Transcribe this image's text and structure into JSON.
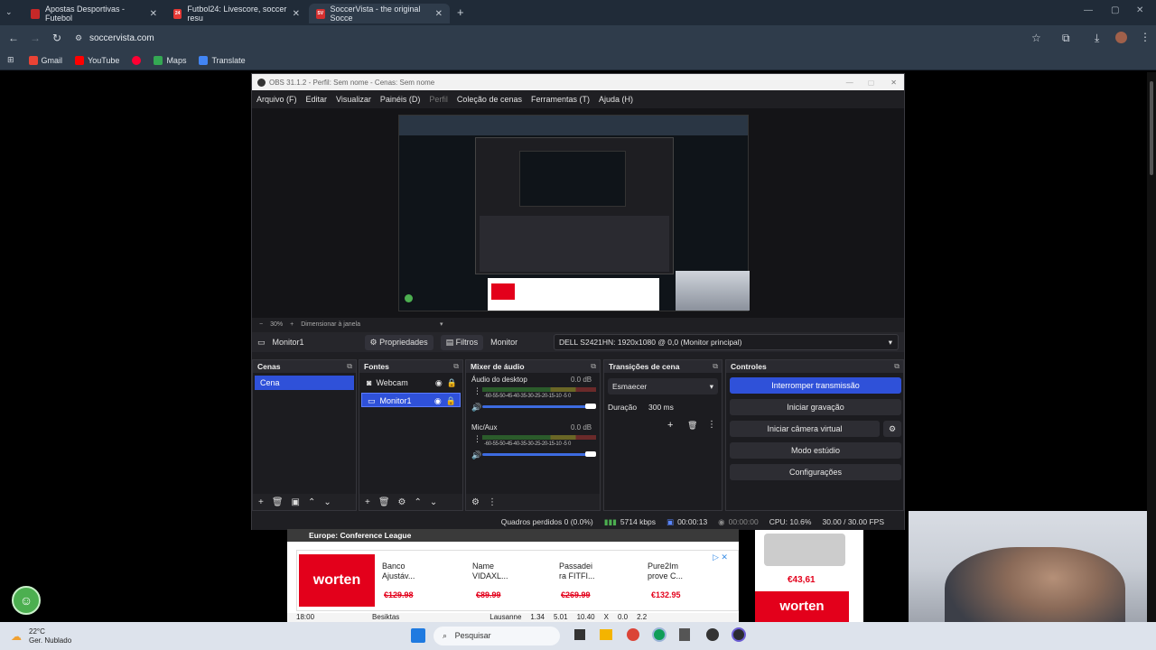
{
  "browser": {
    "tabs": [
      {
        "title": "Apostas Desportivas - Futebol",
        "icon_color": "#c62828",
        "icon_text": ""
      },
      {
        "title": "Futbol24: Livescore, soccer resu",
        "icon_color": "#e53935",
        "icon_text": "24"
      },
      {
        "title": "SoccerVista - the original Socce",
        "icon_color": "#d32f2f",
        "icon_text": "SV",
        "active": true
      }
    ],
    "url": "soccervista.com",
    "bookmarks": [
      "Gmail",
      "YouTube",
      "Maps",
      "Translate"
    ]
  },
  "obs": {
    "title": "OBS 31.1.2 - Perfil: Sem nome - Cenas: Sem nome",
    "menu": [
      "Arquivo (F)",
      "Editar",
      "Visualizar",
      "Painéis (D)",
      "Perfil",
      "Coleção de cenas",
      "Ferramentas (T)",
      "Ajuda (H)"
    ],
    "zoom": "30%",
    "resize_label": "Dimensionar à janela",
    "source_name": "Monitor1",
    "properties_label": "Propriedades",
    "filters_label": "Filtros",
    "monitor_label": "Monitor",
    "monitor_value": "DELL S2421HN: 1920x1080 @ 0,0 (Monitor principal)",
    "docks": {
      "scenes": {
        "title": "Cenas",
        "items": [
          "Cena"
        ]
      },
      "sources": {
        "title": "Fontes",
        "items": [
          "Webcam",
          "Monitor1"
        ]
      },
      "mixer": {
        "title": "Mixer de áudio",
        "channels": [
          {
            "name": "Áudio do desktop",
            "db": "0.0 dB"
          },
          {
            "name": "Mic/Aux",
            "db": "0.0 dB"
          }
        ],
        "scale": "-60-55-50-45-40-35-30-25-20-15-10 -5  0"
      },
      "transitions": {
        "title": "Transições de cena",
        "transition": "Esmaecer",
        "duration_label": "Duração",
        "duration": "300 ms"
      },
      "controls": {
        "title": "Controles",
        "buttons": [
          "Interromper transmissão",
          "Iniciar gravação",
          "Iniciar câmera virtual",
          "Modo estúdio",
          "Configurações"
        ]
      }
    },
    "status": {
      "dropped": "Quadros perdidos 0 (0.0%)",
      "bitrate": "5714 kbps",
      "live_time": "00:00:13",
      "rec_time": "00:00:00",
      "cpu": "CPU: 10.6%",
      "fps": "30.00 / 30.00 FPS"
    }
  },
  "page": {
    "league": "Europe: Conference League",
    "ad_brand": "worten",
    "ad_items": [
      {
        "name": "Banco Ajustáv...",
        "price": "€129.98"
      },
      {
        "name": "Name VIDAXL...",
        "price": "€89.99"
      },
      {
        "name": "Passadei ra FITFI...",
        "price": "€269.99"
      },
      {
        "name": "Pure2Im prove C...",
        "price": "€132.95"
      }
    ],
    "right_price": "€43,61",
    "row_time": "18:00",
    "row_team": "Besiktas",
    "row_opponent": "Lausanne",
    "row_odds": [
      "1.34",
      "5.01",
      "10.40",
      "X",
      "0.0",
      "2.2"
    ]
  },
  "taskbar": {
    "weather_temp": "22°C",
    "weather_text": "Ger. Nublado",
    "search_placeholder": "Pesquisar"
  },
  "colors": {
    "accent": "#2f51d9",
    "obs_bg": "#1f1f23",
    "worten": "#e3001b"
  }
}
